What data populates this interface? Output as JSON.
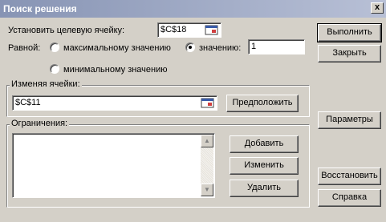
{
  "window": {
    "title": "Поиск решения",
    "close_glyph": "x"
  },
  "target": {
    "label": "Установить целевую ячейку:",
    "value": "$C$18"
  },
  "equal": {
    "label": "Равной:",
    "options": [
      {
        "label": "максимальному значению",
        "selected": false
      },
      {
        "label": "значению:",
        "selected": true
      },
      {
        "label": "минимальному значению",
        "selected": false
      }
    ],
    "value_field": "1"
  },
  "changing": {
    "group_label": "Изменяя ячейки:",
    "value": "$C$11",
    "guess_button": "Предположить"
  },
  "constraints": {
    "group_label": "Ограничения:",
    "items": [],
    "add_button": "Добавить",
    "change_button": "Изменить",
    "delete_button": "Удалить"
  },
  "buttons": {
    "solve": "Выполнить",
    "close": "Закрыть",
    "options": "Параметры",
    "reset": "Восстановить",
    "help": "Справка"
  },
  "colors": {
    "face": "#d4d0c8",
    "title_start": "#8794b4",
    "title_end": "#b8c0d6"
  }
}
